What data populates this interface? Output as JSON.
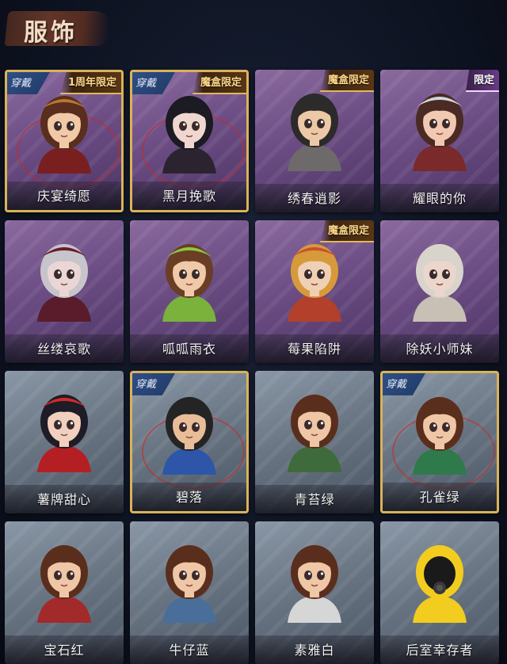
{
  "header": {
    "title": "服饰"
  },
  "badges": {
    "worn": "穿戴"
  },
  "cards": [
    {
      "name": "庆宴绮愿",
      "theme": "purple",
      "worn": true,
      "limit": "1周年限定",
      "hair": "#5a2e1e",
      "skin": "#f1c9a6",
      "cloth": "#7a1f1f",
      "hat": "#b6792e"
    },
    {
      "name": "黑月挽歌",
      "theme": "purple",
      "worn": true,
      "limit": "魔盒限定",
      "hair": "#1c1a22",
      "skin": "#efd7d0",
      "cloth": "#2b2430",
      "hat": ""
    },
    {
      "name": "绣春逍影",
      "theme": "purple",
      "worn": false,
      "limit": "魔盒限定",
      "hair": "#2c2a2a",
      "skin": "#ecc9a6",
      "cloth": "#6e6a6a",
      "hat": ""
    },
    {
      "name": "耀眼的你",
      "theme": "purple",
      "worn": false,
      "limit": "限定",
      "hair": "#4a2a22",
      "skin": "#f1c9b2",
      "cloth": "#7a2a2a",
      "hat": "#cfd8de",
      "limitStyle": "plain"
    },
    {
      "name": "丝缕哀歌",
      "theme": "purple",
      "worn": false,
      "limit": "",
      "hair": "#c8c4cc",
      "skin": "#ead7d5",
      "cloth": "#5a1c2a",
      "hat": "#6a1a28"
    },
    {
      "name": "呱呱雨衣",
      "theme": "purple",
      "worn": false,
      "limit": "",
      "hair": "#6a3e24",
      "skin": "#f0c9a8",
      "cloth": "#7bb23c",
      "hat": "#8cc842"
    },
    {
      "name": "莓果陷阱",
      "theme": "purple",
      "worn": false,
      "limit": "魔盒限定",
      "hair": "#d79a3a",
      "skin": "#f0d0b4",
      "cloth": "#b2402a",
      "hat": "#c9502c"
    },
    {
      "name": "除妖小师妹",
      "theme": "purple",
      "worn": false,
      "limit": "",
      "hair": "#d8d4cc",
      "skin": "#ecd6cc",
      "cloth": "#c8c0b4",
      "hat": ""
    },
    {
      "name": "薯牌甜心",
      "theme": "grey",
      "worn": false,
      "limit": "",
      "hair": "#1e1c26",
      "skin": "#f1d0c0",
      "cloth": "#b41f24",
      "hat": "#d22a2a"
    },
    {
      "name": "碧落",
      "theme": "grey",
      "worn": true,
      "limit": "",
      "hair": "#242424",
      "skin": "#e9bd98",
      "cloth": "#2d56a8",
      "hat": ""
    },
    {
      "name": "青苔绿",
      "theme": "grey",
      "worn": false,
      "limit": "",
      "hair": "#5a2e1c",
      "skin": "#efc6a6",
      "cloth": "#3f6a3c",
      "hat": ""
    },
    {
      "name": "孔雀绿",
      "theme": "grey",
      "worn": true,
      "limit": "",
      "hair": "#5a2e1c",
      "skin": "#efc6a6",
      "cloth": "#2e7a4a",
      "hat": ""
    },
    {
      "name": "宝石红",
      "theme": "grey",
      "worn": false,
      "limit": "",
      "hair": "#5a2e1c",
      "skin": "#efc6a6",
      "cloth": "#a32a2a",
      "hat": ""
    },
    {
      "name": "牛仔蓝",
      "theme": "grey",
      "worn": false,
      "limit": "",
      "hair": "#5a2e1c",
      "skin": "#efc6a6",
      "cloth": "#4a6e9a",
      "hat": ""
    },
    {
      "name": "素雅白",
      "theme": "grey",
      "worn": false,
      "limit": "",
      "hair": "#5a2e1c",
      "skin": "#efc6a6",
      "cloth": "#d6d6d6",
      "hat": ""
    },
    {
      "name": "后室幸存者",
      "theme": "grey",
      "worn": false,
      "limit": "",
      "hair": "#f2cc1e",
      "skin": "#2a2a2a",
      "cloth": "#f2cc1e",
      "hat": "#f2cc1e",
      "mask": "gas-mask"
    }
  ]
}
